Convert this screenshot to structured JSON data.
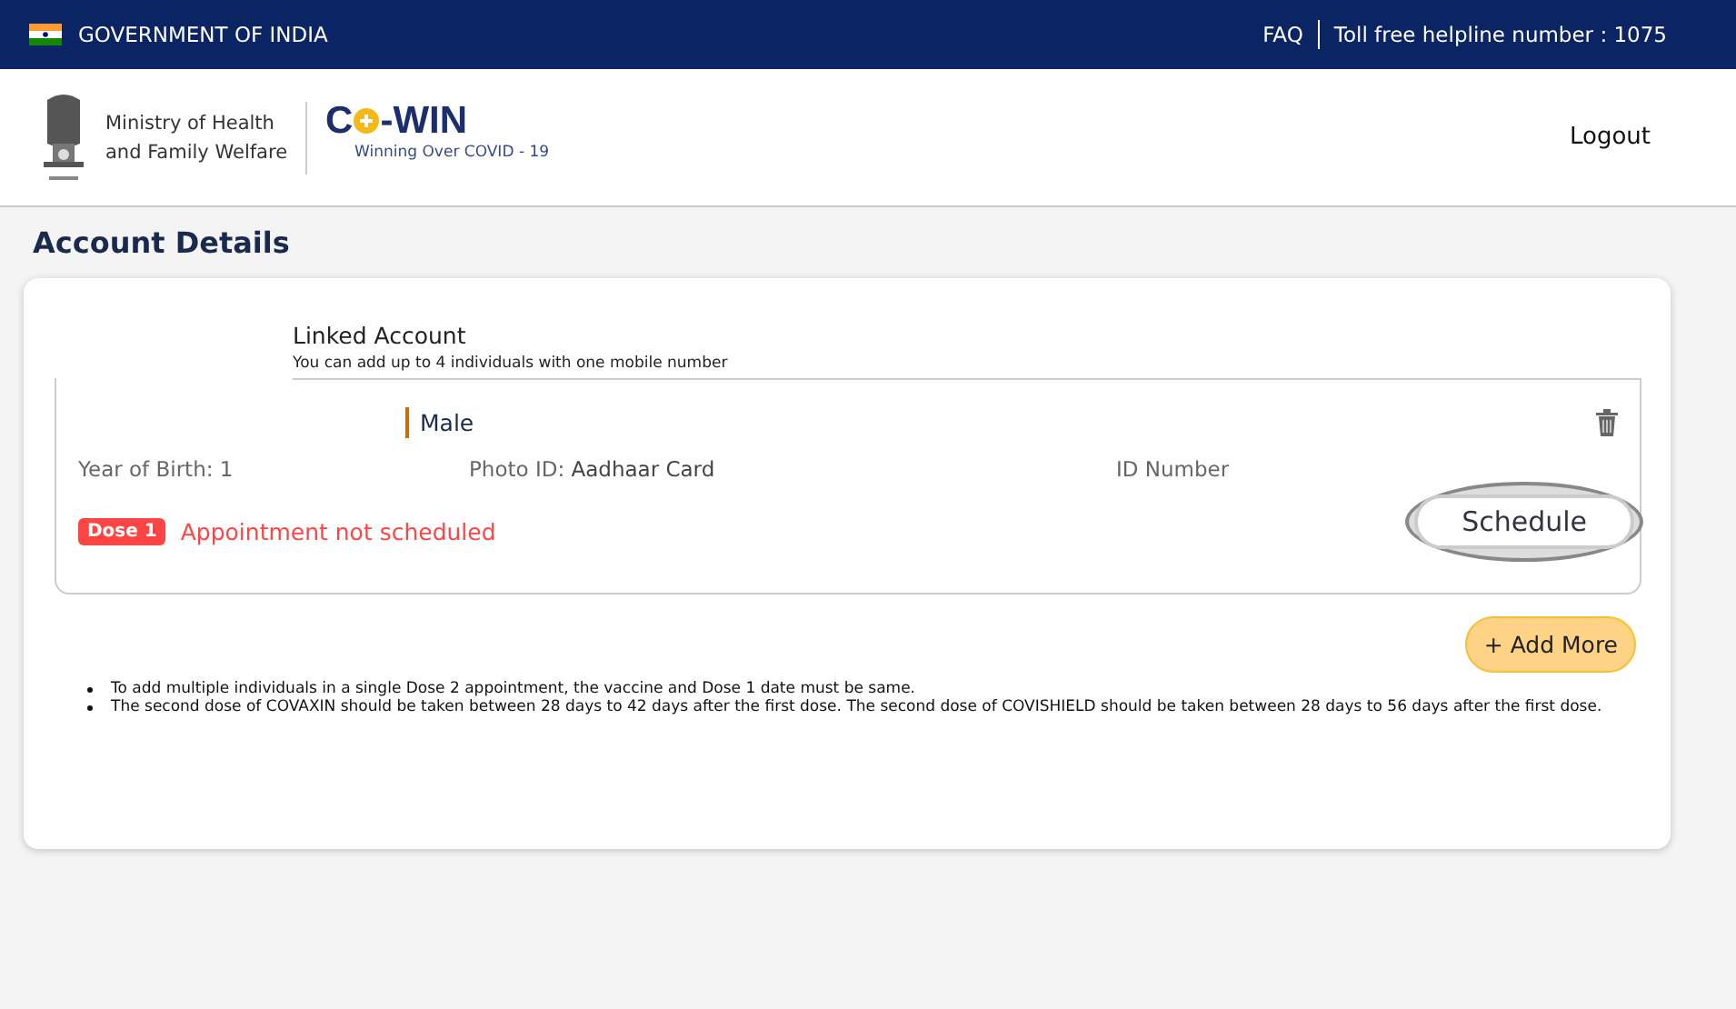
{
  "top_bar": {
    "title": "GOVERNMENT OF INDIA",
    "links": [
      "FAQ",
      "Toll free helpline number : 1075"
    ]
  },
  "header": {
    "ministry_lines": [
      "Ministry of Health",
      "and Family Welfare"
    ],
    "logo_text": "C",
    "logo_text_2": "-WIN",
    "tagline": "Winning Over COVID - 19",
    "logout": "Logout"
  },
  "page_title": "Account Details",
  "linked": {
    "title": "Linked Account",
    "subtitle": "You can add up to 4 individuals with one mobile number"
  },
  "members": [
    {
      "gender": "Male",
      "year_of_birth": "Year of Birth:  1",
      "photo_id_label": "Photo ID:",
      "photo_id": "Aadhaar Card",
      "id_number": "ID Number",
      "dose_badge": "Dose 1",
      "status": "Appointment not scheduled",
      "action": "Schedule"
    }
  ],
  "add_more": "+ Add More",
  "notes": [
    {
      "text": "To add multiple individuals in a single Dose 2 appointment, the vaccine and Dose 1 date must be same."
    },
    {
      "text": "The second dose of COVAXIN should be taken between 28 days to 42 days after the first dose. The second dose of COVISHIELD should be taken between 28 days to 56 days after the first dose."
    }
  ]
}
